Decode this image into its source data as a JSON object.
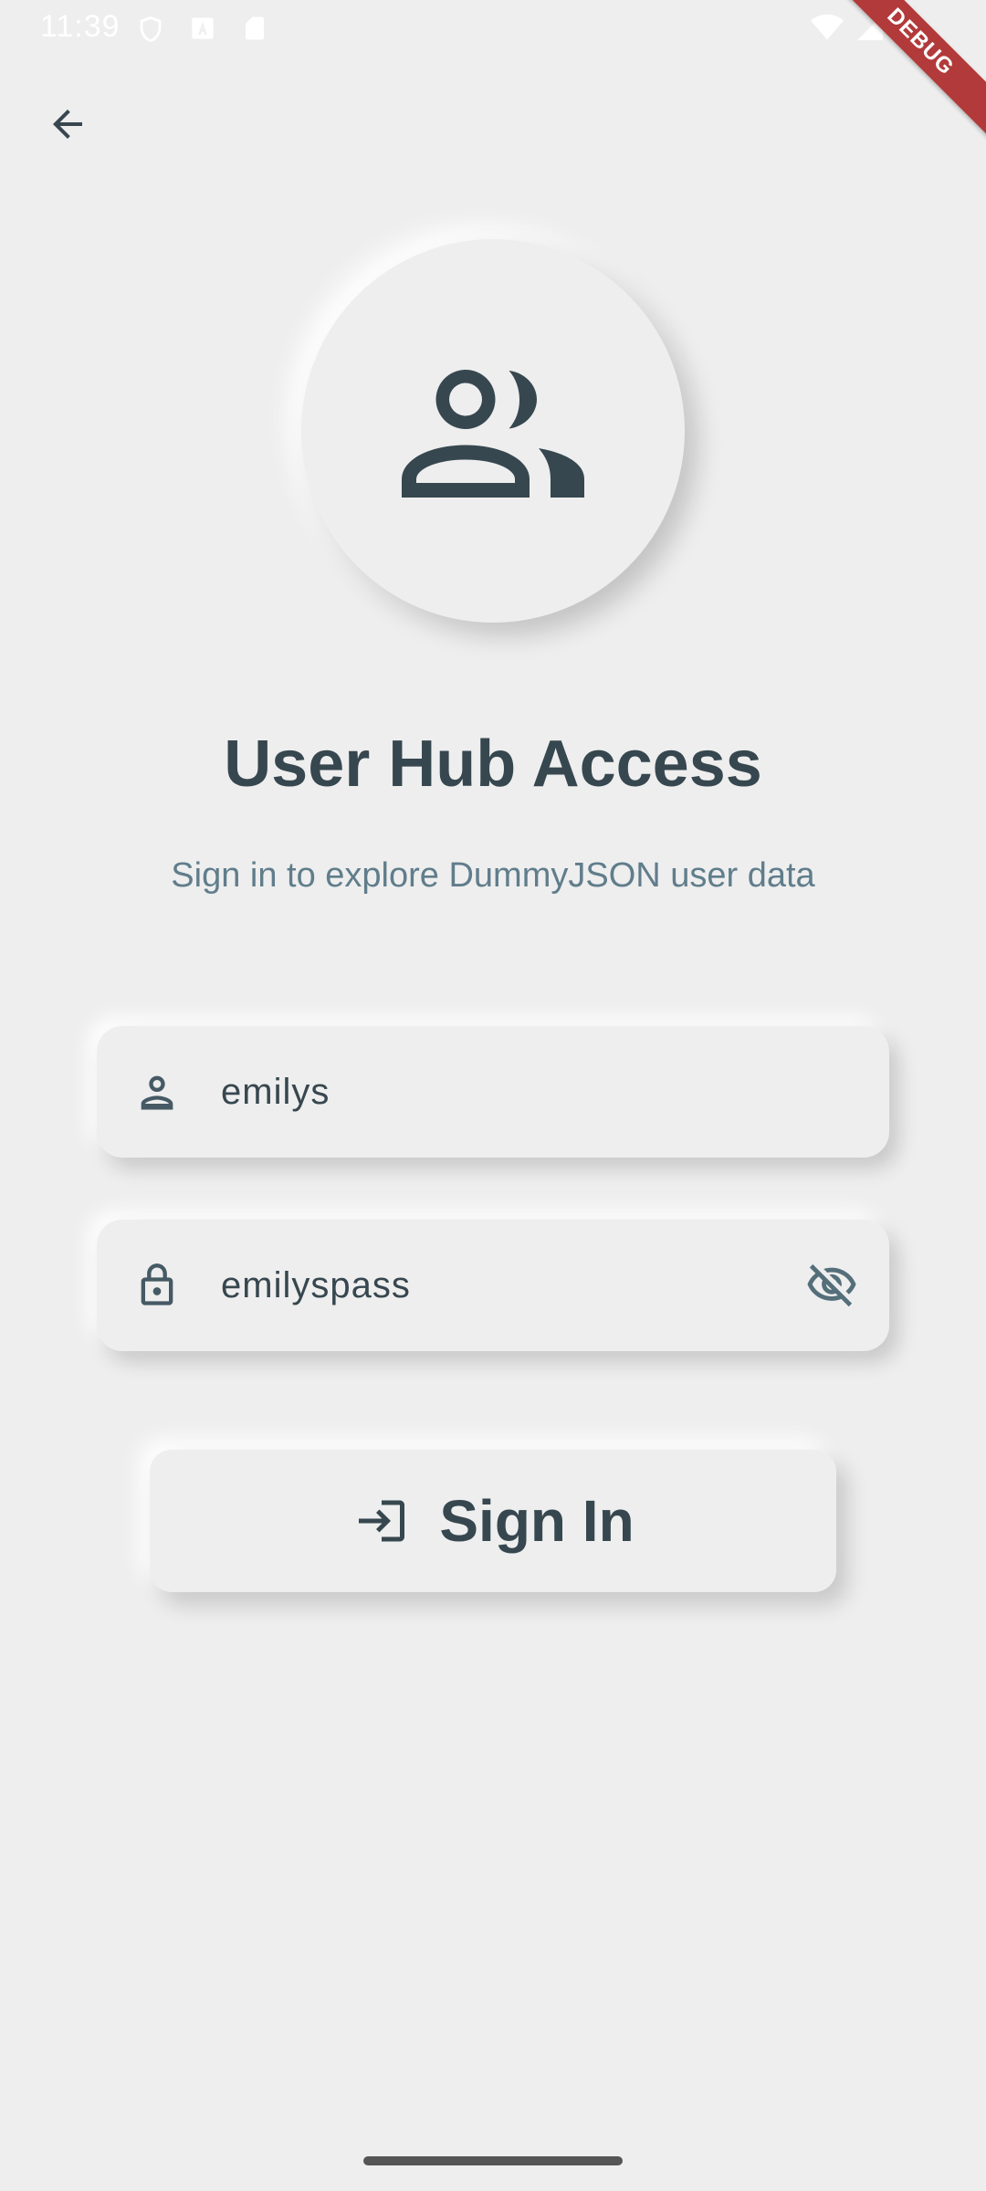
{
  "status_bar": {
    "time": "11:39",
    "icons": [
      "shield-icon",
      "a-badge-icon",
      "sd-card-icon",
      "wifi-icon",
      "signal-icon",
      "battery-icon"
    ]
  },
  "debug_banner": {
    "label": "DEBUG",
    "color": "#b23a3a"
  },
  "header": {
    "back_icon": "arrow-left-icon"
  },
  "hero": {
    "icon": "group-icon"
  },
  "title": "User Hub Access",
  "subtitle": "Sign in to explore DummyJSON user data",
  "form": {
    "username": {
      "value": "emilys",
      "icon": "person-icon"
    },
    "password": {
      "value": "emilyspass",
      "icon": "lock-icon",
      "toggle_icon": "visibility-off-icon"
    }
  },
  "signin_button": {
    "label": "Sign In",
    "icon": "login-icon"
  },
  "colors": {
    "background": "#eeeeee",
    "primary_text": "#37474f",
    "secondary_text": "#607d8b"
  }
}
